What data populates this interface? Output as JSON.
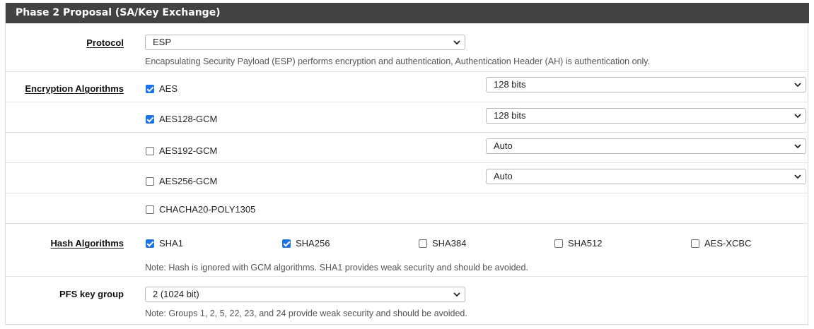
{
  "panel": {
    "title": "Phase 2 Proposal (SA/Key Exchange)"
  },
  "protocol": {
    "label": "Protocol",
    "selected": "ESP",
    "help": "Encapsulating Security Payload (ESP) performs encryption and authentication, Authentication Header (AH) is authentication only."
  },
  "encryption": {
    "label": "Encryption Algorithms",
    "items": [
      {
        "name": "AES",
        "checked": true,
        "keylen": "128 bits"
      },
      {
        "name": "AES128-GCM",
        "checked": true,
        "keylen": "128 bits"
      },
      {
        "name": "AES192-GCM",
        "checked": false,
        "keylen": "Auto"
      },
      {
        "name": "AES256-GCM",
        "checked": false,
        "keylen": "Auto"
      },
      {
        "name": "CHACHA20-POLY1305",
        "checked": false
      }
    ]
  },
  "hash": {
    "label": "Hash Algorithms",
    "items": [
      {
        "name": "SHA1",
        "checked": true
      },
      {
        "name": "SHA256",
        "checked": true
      },
      {
        "name": "SHA384",
        "checked": false
      },
      {
        "name": "SHA512",
        "checked": false
      },
      {
        "name": "AES-XCBC",
        "checked": false
      }
    ],
    "note": "Note: Hash is ignored with GCM algorithms. SHA1 provides weak security and should be avoided."
  },
  "pfs": {
    "label": "PFS key group",
    "selected": "2 (1024 bit)",
    "note": "Note: Groups 1, 2, 5, 22, 23, and 24 provide weak security and should be avoided."
  },
  "colors": {
    "header": "#424242",
    "checkbox": "#1a73e8"
  }
}
